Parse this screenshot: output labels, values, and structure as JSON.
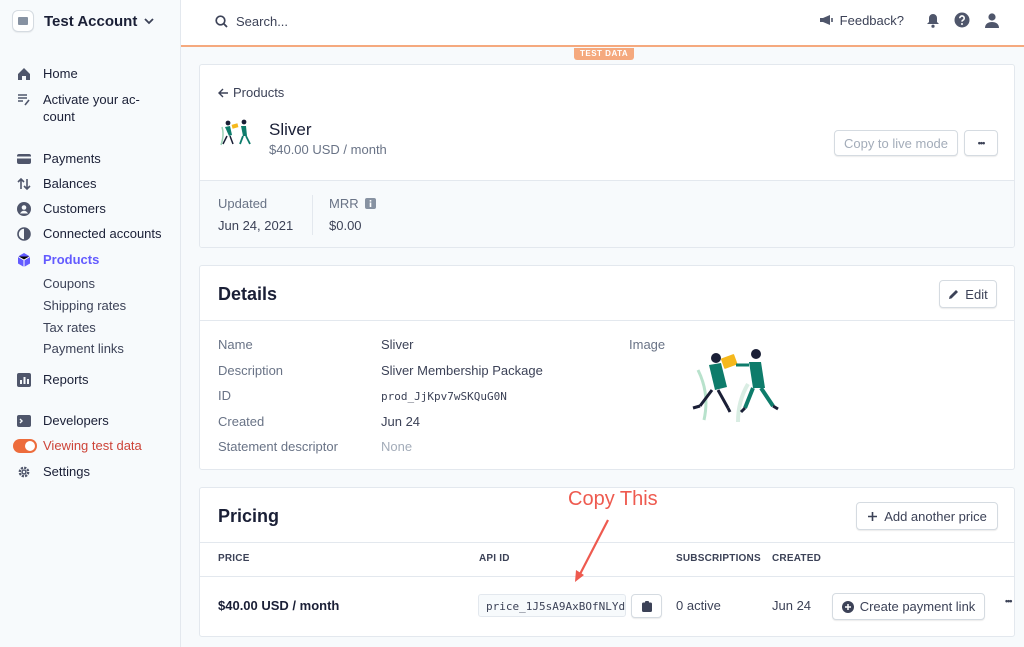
{
  "sidebar": {
    "account_name": "Test Account",
    "items": [
      {
        "label": "Home",
        "icon": "home-icon"
      },
      {
        "label": "Activate your ac-\ncount",
        "icon": "checklist-icon"
      },
      {
        "label": "Payments",
        "icon": "payments-icon"
      },
      {
        "label": "Balances",
        "icon": "balances-icon"
      },
      {
        "label": "Customers",
        "icon": "customers-icon"
      },
      {
        "label": "Connected accounts",
        "icon": "connected-icon"
      },
      {
        "label": "Products",
        "icon": "products-icon"
      },
      {
        "label": "Reports",
        "icon": "reports-icon"
      },
      {
        "label": "Developers",
        "icon": "developers-icon"
      },
      {
        "label": "Viewing test data",
        "icon": "toggle"
      },
      {
        "label": "Settings",
        "icon": "gear-icon"
      }
    ],
    "sub_items": [
      "Coupons",
      "Shipping rates",
      "Tax rates",
      "Payment links"
    ],
    "accent": "#635bff",
    "test_color": "#cd4338"
  },
  "topbar": {
    "search_placeholder": "Search...",
    "feedback_label": "Feedback?",
    "test_badge": "TEST DATA",
    "test_accent": "#f5a97e"
  },
  "product": {
    "back_label": "Products",
    "name": "Sliver",
    "price": "$40.00 USD / month",
    "copy_live_label": "Copy to live mode",
    "more_label": "•••",
    "updated_label": "Updated",
    "updated_value": "Jun 24, 2021",
    "mrr_label": "MRR",
    "mrr_value": "$0.00"
  },
  "details": {
    "title": "Details",
    "edit_label": "Edit",
    "rows": [
      {
        "label": "Name",
        "value": "Sliver"
      },
      {
        "label": "Description",
        "value": "Sliver Membership Package"
      },
      {
        "label": "ID",
        "value": "prod_JjKpv7wSKQuG0N"
      },
      {
        "label": "Created",
        "value": "Jun 24"
      },
      {
        "label": "Statement descriptor",
        "value": "None"
      }
    ],
    "image_label": "Image"
  },
  "pricing": {
    "title": "Pricing",
    "add_price_label": "Add another price",
    "headers": [
      "PRICE",
      "API ID",
      "SUBSCRIPTIONS",
      "CREATED"
    ],
    "row": {
      "price": "$40.00 USD / month",
      "api_id": "price_1J5sA9AxBOfNLYd",
      "subscriptions": "0 active",
      "created": "Jun 24",
      "create_link_label": "Create payment link",
      "more": "•••"
    }
  },
  "annotation": {
    "text": "Copy This",
    "color": "#ee5a4f"
  }
}
